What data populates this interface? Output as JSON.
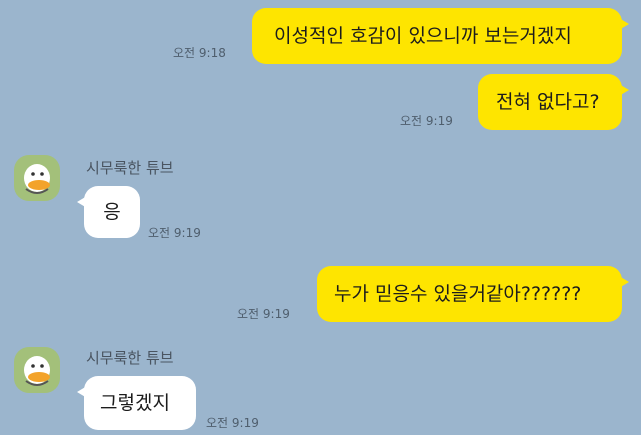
{
  "messages": [
    {
      "text": "이성적인 호감이 있으니까 보는거겠지",
      "time": "오전 9:18"
    },
    {
      "text": "전혀 없다고?",
      "time": "오전 9:19"
    },
    {
      "sender": "시무룩한 튜브",
      "text": "응",
      "time": "오전 9:19"
    },
    {
      "text": "누가 믿응수 있을거같아??????",
      "time": "오전 9:19"
    },
    {
      "sender": "시무룩한 튜브",
      "text": "그렇겠지",
      "time": "오전 9:19"
    }
  ],
  "colors": {
    "background": "#9bb5cd",
    "my_bubble": "#fee500",
    "their_bubble": "#ffffff",
    "avatar_bg": "#a3c07a"
  },
  "icons": {
    "avatar": "tube-duck-avatar"
  }
}
